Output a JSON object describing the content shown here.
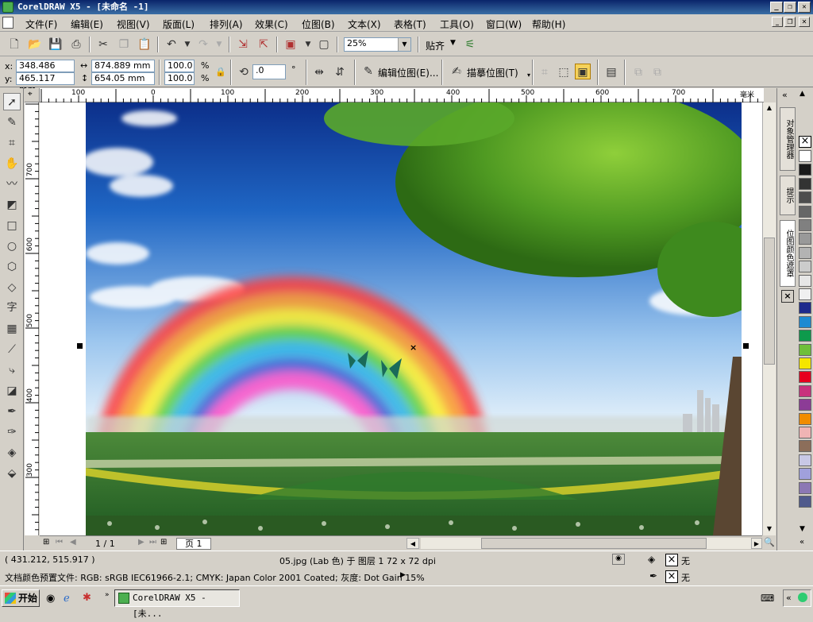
{
  "window": {
    "title": "CorelDRAW X5 - [未命名 -1]",
    "minimize": "_",
    "restore": "❐",
    "close": "✕"
  },
  "menu": [
    "文件(F)",
    "编辑(E)",
    "视图(V)",
    "版面(L)",
    "排列(A)",
    "效果(C)",
    "位图(B)",
    "文本(X)",
    "表格(T)",
    "工具(O)",
    "窗口(W)",
    "帮助(H)"
  ],
  "toolbar": {
    "zoom_value": "25%",
    "snap_label": "贴齐"
  },
  "property_bar": {
    "x_label": "x:",
    "x_value": "348.486 mm",
    "y_label": "y:",
    "y_value": "465.117 mm",
    "width_value": "874.889 mm",
    "height_value": "654.05 mm",
    "scale_w": "100.0",
    "scale_h": "100.0",
    "percent": "%",
    "rotation_value": ".0",
    "degree": "°",
    "edit_bitmap_label": "编辑位图(E)...",
    "trace_bitmap_label": "描摹位图(T)"
  },
  "ruler": {
    "unit": "毫米",
    "h_ticks": [
      "100",
      "0",
      "100",
      "200",
      "300",
      "400",
      "500",
      "600",
      "700"
    ],
    "v_ticks": [
      "700",
      "600",
      "500",
      "400",
      "300"
    ]
  },
  "docker_tabs": [
    "对象管理器",
    "提示",
    "位图颜色遮罩"
  ],
  "palette_colors": [
    "#ffffff",
    "#1a1a1a",
    "#333333",
    "#4d4d4d",
    "#666666",
    "#808080",
    "#999999",
    "#b3b3b3",
    "#cccccc",
    "#e6e6e6",
    "#f0f0f0",
    "#1e2a8c",
    "#1e8ad2",
    "#0e9a4c",
    "#6fbf3a",
    "#f5e600",
    "#e6001e",
    "#c8327d",
    "#8c3c96",
    "#f08c00",
    "#f0b4b4",
    "#8c6e5a",
    "#c8c8e6",
    "#a0a0dc",
    "#8c78b4",
    "#505a8c"
  ],
  "page_nav": {
    "counter": "1 / 1",
    "page_tab": "页 1"
  },
  "status": {
    "coords": "( 431.212, 515.917 )",
    "object_info": "05.jpg (Lab 色) 于 图层 1 72 x 72 dpi",
    "color_profile": "文档颜色预置文件: RGB: sRGB IEC61966-2.1; CMYK: Japan Color 2001 Coated; 灰度: Dot Gain 15%",
    "fill_none": "无",
    "outline_none": "无"
  },
  "taskbar": {
    "start_label": "开始",
    "task_label": "CorelDRAW X5 - [未..."
  }
}
